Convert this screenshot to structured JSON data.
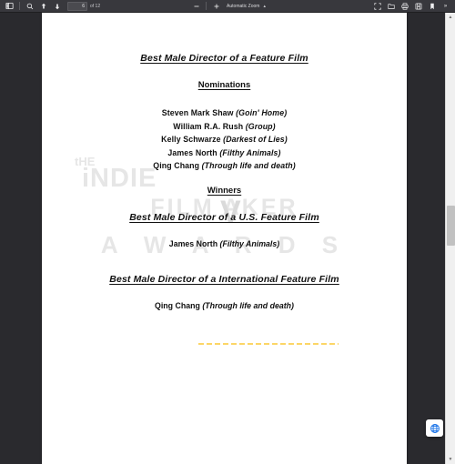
{
  "toolbar": {
    "sidebar_toggle": "sidebar-toggle",
    "find": "find",
    "prev_page": "previous-page",
    "next_page": "next-page",
    "page_number_value": "6",
    "page_count_label": "of 12",
    "zoom_out": "zoom-out",
    "zoom_in": "zoom-in",
    "zoom_level": "Automatic Zoom",
    "zoom_caret": "▴",
    "presentation_mode": "presentation-mode",
    "open_file": "open-file",
    "print": "print",
    "save": "save",
    "bookmark": "current-view",
    "more_tools": "»"
  },
  "document": {
    "title_main": "Best Male Director of a Feature Film",
    "nominations_heading": "Nominations",
    "nominees": [
      {
        "name": "Steven Mark Shaw",
        "film": "(Goin' Home)"
      },
      {
        "name": "William R.A. Rush",
        "film": "(Group)"
      },
      {
        "name": "Kelly Schwarze",
        "film": "(Darkest of Lies)"
      },
      {
        "name": "James North",
        "film": "(Filthy Animals)"
      },
      {
        "name": "Qing Chang",
        "film": "(Through life and death)"
      }
    ],
    "winners_heading": "Winners",
    "us_category_title": "Best Male Director of a U.S. Feature Film",
    "us_winner": {
      "name": "James North",
      "film": "(Filthy Animals)"
    },
    "intl_category_title": "Best Male Director of a International Feature Film",
    "intl_winner": {
      "name": "Qing Chang",
      "film": "(Through life and death)"
    },
    "divider": "dashed-divider"
  },
  "watermark": {
    "line1": "tHE",
    "line2": "iNDIE",
    "line3": "FILM      AKER",
    "line4": "A W A R D S",
    "mark": "V"
  },
  "scrollbar": {
    "up_arrow": "▲",
    "down_arrow": "▼"
  },
  "float_button": {
    "name": "globe-translate-button"
  },
  "colors": {
    "toolbar_bg": "#38383d",
    "viewer_bg": "#2a2a2e",
    "page_bg": "#ffffff",
    "accent_dash": "#fcd667",
    "float_icon": "#1a73e8"
  }
}
